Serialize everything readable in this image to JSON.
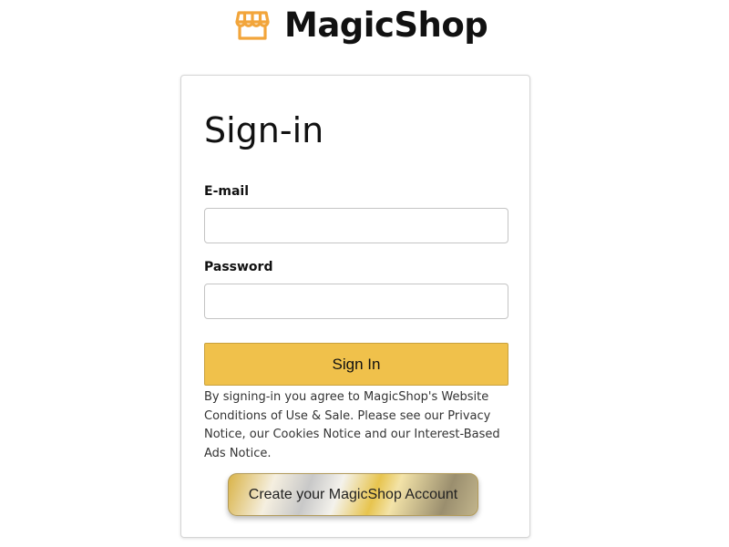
{
  "header": {
    "brand_name": "MagicShop",
    "brand_icon": "storefront-icon",
    "brand_icon_color": "#f2a53b"
  },
  "signin_form": {
    "title": "Sign-in",
    "email_label": "E-mail",
    "email_value": "",
    "password_label": "Password",
    "password_value": "",
    "submit_label": "Sign In",
    "submit_color": "#f0c14b",
    "terms_text": "By signing-in you agree to MagicShop's Website Conditions of Use & Sale. Please see our Privacy Notice, our Cookies Notice and our Interest-Based Ads Notice.",
    "create_account_label": "Create your MagicShop Account"
  }
}
